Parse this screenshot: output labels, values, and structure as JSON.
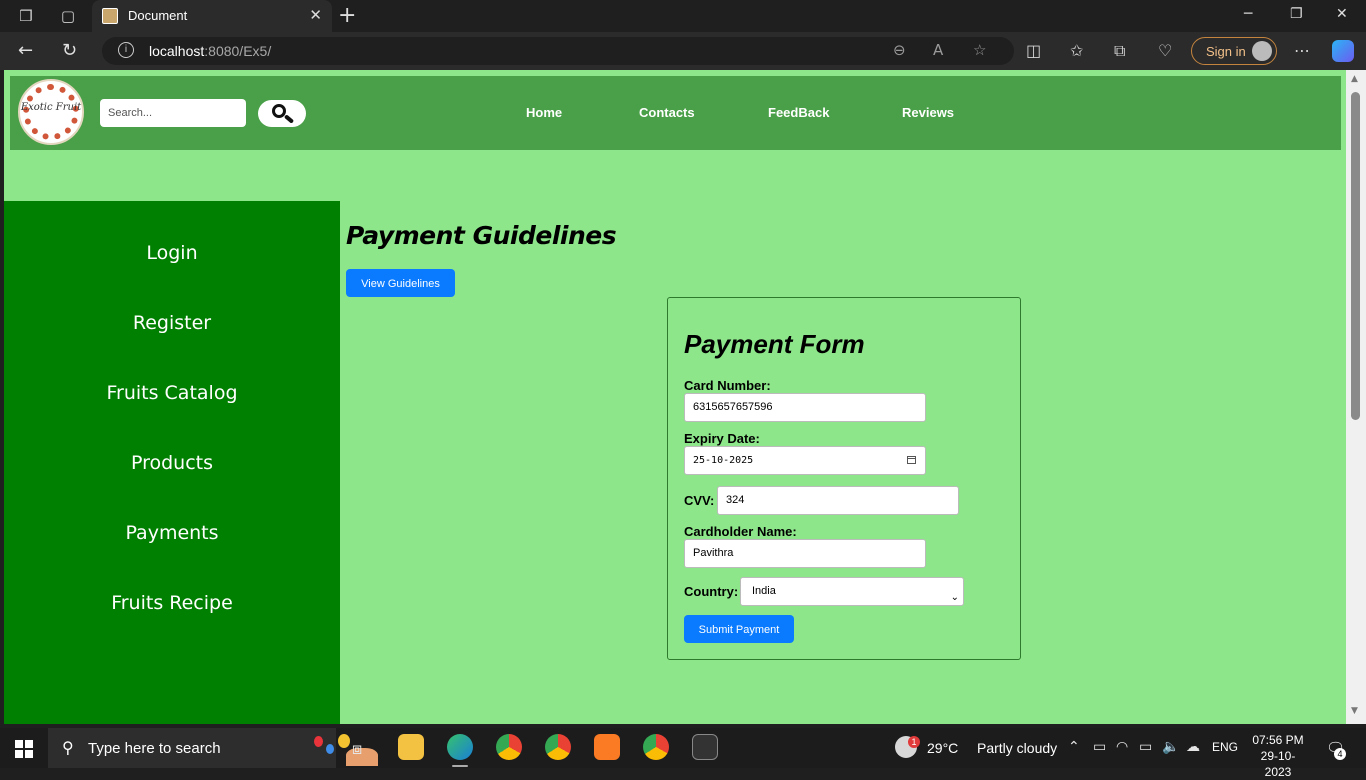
{
  "browser": {
    "tab_title": "Document",
    "url_host": "localhost",
    "url_rest": ":8080/Ex5/",
    "signin_label": "Sign in",
    "icons": [
      "workspaces-icon",
      "tab-actions-icon",
      "back-icon",
      "refresh-icon",
      "zoom-out-icon",
      "read-aloud-icon",
      "favorite-icon",
      "split-screen-icon",
      "favorites-icon",
      "collections-icon",
      "browser-essentials-icon",
      "more-icon",
      "copilot-icon"
    ]
  },
  "site": {
    "logo_text": "Exotic Fruit",
    "search_placeholder": "Search...",
    "nav": [
      "Home",
      "Contacts",
      "FeedBack",
      "Reviews"
    ],
    "sidebar": [
      "Login",
      "Register",
      "Fruits Catalog",
      "Products",
      "Payments",
      "Fruits Recipe"
    ],
    "colors": {
      "header": "#4aa049",
      "sidebar": "#008000",
      "page_bg": "#8de68a",
      "button": "#0a7bff"
    }
  },
  "main": {
    "title": "Payment Guidelines",
    "view_button": "View Guidelines"
  },
  "form": {
    "title": "Payment Form",
    "card_number_label": "Card Number:",
    "card_number_value": "6315657657596",
    "expiry_label": "Expiry Date:",
    "expiry_value": "25-10-2025",
    "cvv_label": "CVV:",
    "cvv_value": "324",
    "cardholder_label": "Cardholder Name:",
    "cardholder_value": "Pavithra",
    "country_label": "Country:",
    "country_value": "India",
    "submit_label": "Submit Payment"
  },
  "taskbar": {
    "search_text": "Type here to search",
    "weather_temp": "29°C",
    "weather_desc": "Partly cloudy",
    "language": "ENG",
    "time": "07:56 PM",
    "date": "29-10-2023",
    "notification_count": "4",
    "weather_badge": "1"
  }
}
